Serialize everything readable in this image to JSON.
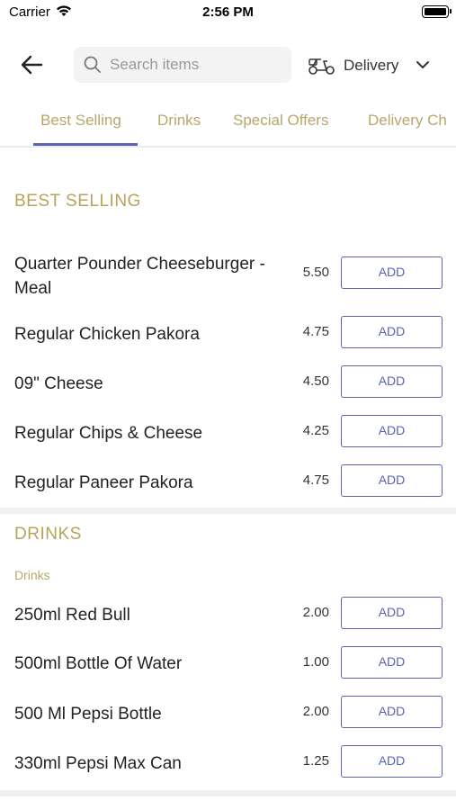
{
  "status_bar": {
    "carrier": "Carrier",
    "time": "2:56 PM"
  },
  "header": {
    "search_placeholder": "Search items",
    "order_mode": "Delivery"
  },
  "tabs": [
    {
      "label": "Best Selling",
      "active": true
    },
    {
      "label": "Drinks",
      "active": false
    },
    {
      "label": "Special Offers",
      "active": false
    },
    {
      "label": "Delivery Ch",
      "active": false
    }
  ],
  "sections": [
    {
      "title": "BEST SELLING",
      "items": [
        {
          "name": "Quarter Pounder Cheeseburger - Meal",
          "price": "5.50",
          "button": "ADD"
        },
        {
          "name": "Regular Chicken Pakora",
          "price": "4.75",
          "button": "ADD"
        },
        {
          "name": "09\" Cheese",
          "price": "4.50",
          "button": "ADD"
        },
        {
          "name": "Regular Chips & Cheese",
          "price": "4.25",
          "button": "ADD"
        },
        {
          "name": "Regular Paneer Pakora",
          "price": "4.75",
          "button": "ADD"
        }
      ]
    },
    {
      "title": "DRINKS",
      "subcategory": "Drinks",
      "items": [
        {
          "name": "250ml Red Bull",
          "price": "2.00",
          "button": "ADD"
        },
        {
          "name": "500ml Bottle Of Water",
          "price": "1.00",
          "button": "ADD"
        },
        {
          "name": "500 Ml Pepsi Bottle",
          "price": "2.00",
          "button": "ADD"
        },
        {
          "name": "330ml Pepsi Max Can",
          "price": "1.25",
          "button": "ADD"
        }
      ]
    }
  ],
  "colors": {
    "accent": "#5b63b7",
    "section_title": "#b8a35a",
    "divider": "#f0f0f0"
  }
}
